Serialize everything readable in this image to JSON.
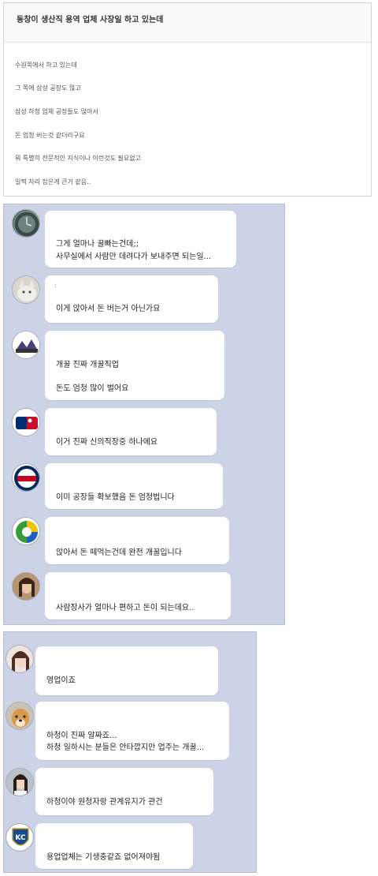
{
  "post": {
    "title": "동창이 생산직 용역 업체 사장일 하고 있는데",
    "lines": [
      "수원쪽에서 하고 있는데",
      "그 쪽에 삼성 공장도 많고",
      "삼성 하청 업체 공장들도 많아서",
      "돈 엄청 버는것 같더라구요",
      "뭐 특별히 전문적인 지식이나 이런것도 필요없고",
      "일찍 자리 잡은게 큰거 같음.."
    ]
  },
  "panel1": {
    "comments": [
      {
        "avatar": "clock-avatar",
        "lines": [
          "그게 얼마나 꿀빠는건데;;",
          "사무실에서 사람만 데려다가 보내주면 되는일..."
        ]
      },
      {
        "avatar": "cat-avatar",
        "mark": ":",
        "lines": [
          "이게 앉아서 돈 버는거 아닌가요"
        ]
      },
      {
        "avatar": "rockies-logo-avatar",
        "lines": [
          "개꿀 진짜 개꿀직업",
          "돈도 엄청 많이 벌어요"
        ]
      },
      {
        "avatar": "mlb-logo-avatar",
        "lines": [
          "이거 진짜 신의직장중 하나에요"
        ]
      },
      {
        "avatar": "twins-logo-avatar",
        "lines": [
          "이미 공장들 확보했음 돈 엄청법니다"
        ]
      },
      {
        "avatar": "baseball-classic-logo-avatar",
        "lines": [
          "앉아서 돈 떼먹는건데 완전 개꿀입니다"
        ]
      },
      {
        "avatar": "woman-photo-avatar",
        "lines": [
          "사람장사가 얼마나 편하고 돈이 되는데요.."
        ]
      }
    ]
  },
  "panel2": {
    "comments": [
      {
        "avatar": "girl-photo-avatar",
        "lines": [
          "영업이죠"
        ]
      },
      {
        "avatar": "dog-photo-avatar",
        "lines": [
          "하청이 진짜 알짜죠...",
          "하청 일하시는 분들은 안타깝지만 업주는 개꿀..."
        ]
      },
      {
        "avatar": "woman-photo-avatar-2",
        "lines": [
          "하청이야 원청자랑 관계유지가 관건"
        ]
      },
      {
        "avatar": "royals-logo-avatar",
        "lines": [
          "용업업체는 기생충같죠 없어져야됨"
        ]
      }
    ]
  }
}
